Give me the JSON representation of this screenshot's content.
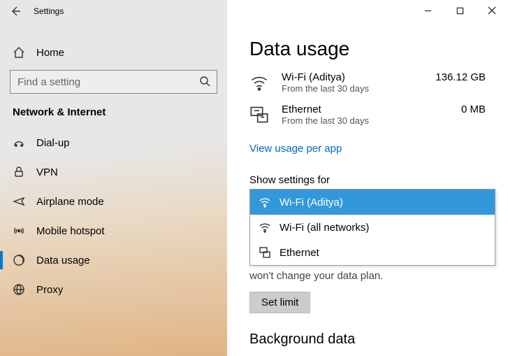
{
  "window": {
    "title": "Settings"
  },
  "sidebar": {
    "home_label": "Home",
    "search_placeholder": "Find a setting",
    "category": "Network & Internet",
    "items": [
      {
        "label": "Dial-up",
        "icon": "dialup-icon"
      },
      {
        "label": "VPN",
        "icon": "vpn-icon"
      },
      {
        "label": "Airplane mode",
        "icon": "airplane-icon"
      },
      {
        "label": "Mobile hotspot",
        "icon": "hotspot-icon"
      },
      {
        "label": "Data usage",
        "icon": "data-usage-icon",
        "active": true
      },
      {
        "label": "Proxy",
        "icon": "proxy-icon"
      }
    ]
  },
  "main": {
    "title": "Data usage",
    "usage": [
      {
        "name": "Wi-Fi (Aditya)",
        "sub": "From the last 30 days",
        "value": "136.12 GB",
        "icon": "wifi-icon"
      },
      {
        "name": "Ethernet",
        "sub": "From the last 30 days",
        "value": "0 MB",
        "icon": "ethernet-icon"
      }
    ],
    "view_link": "View usage per app",
    "show_settings_label": "Show settings for",
    "dropdown": {
      "options": [
        {
          "label": "Wi-Fi (Aditya)",
          "icon": "wifi-icon",
          "selected": true
        },
        {
          "label": "Wi-Fi (all networks)",
          "icon": "wifi-icon"
        },
        {
          "label": "Ethernet",
          "icon": "ethernet-icon"
        }
      ]
    },
    "plan_hint": "won't change your data plan.",
    "set_limit_btn": "Set limit",
    "bg_section_title": "Background data"
  }
}
